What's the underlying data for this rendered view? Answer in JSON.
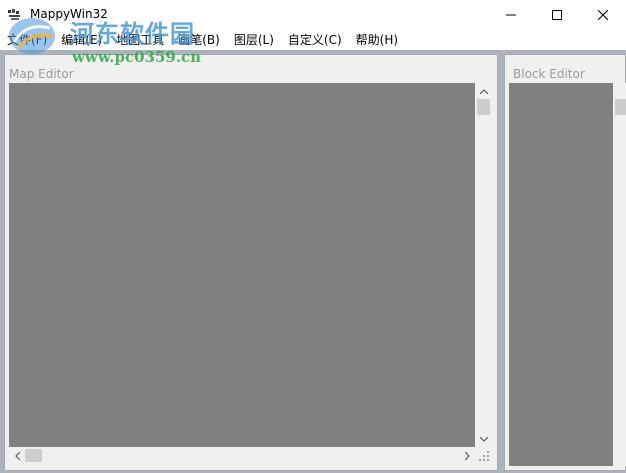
{
  "window": {
    "title": "MappyWin32",
    "minimize_icon": "minimize-icon",
    "maximize_icon": "maximize-icon",
    "close_icon": "close-icon"
  },
  "menu": {
    "items": [
      {
        "label": "文件(F)"
      },
      {
        "label": "编辑(E)"
      },
      {
        "label": "地图工具"
      },
      {
        "label": "画笔(B)"
      },
      {
        "label": "图层(L)"
      },
      {
        "label": "自定义(C)"
      },
      {
        "label": "帮助(H)"
      }
    ]
  },
  "panels": {
    "map_editor": {
      "title": "Map Editor"
    },
    "block_editor": {
      "title": "Block Editor"
    }
  },
  "watermark": {
    "text": "河东软件园",
    "url": "www.pc0359.cn"
  },
  "colors": {
    "canvas": "#808080",
    "client_background": "#abb4be",
    "panel": "#f0f0f0",
    "panel_title": "#9a9a9a"
  }
}
